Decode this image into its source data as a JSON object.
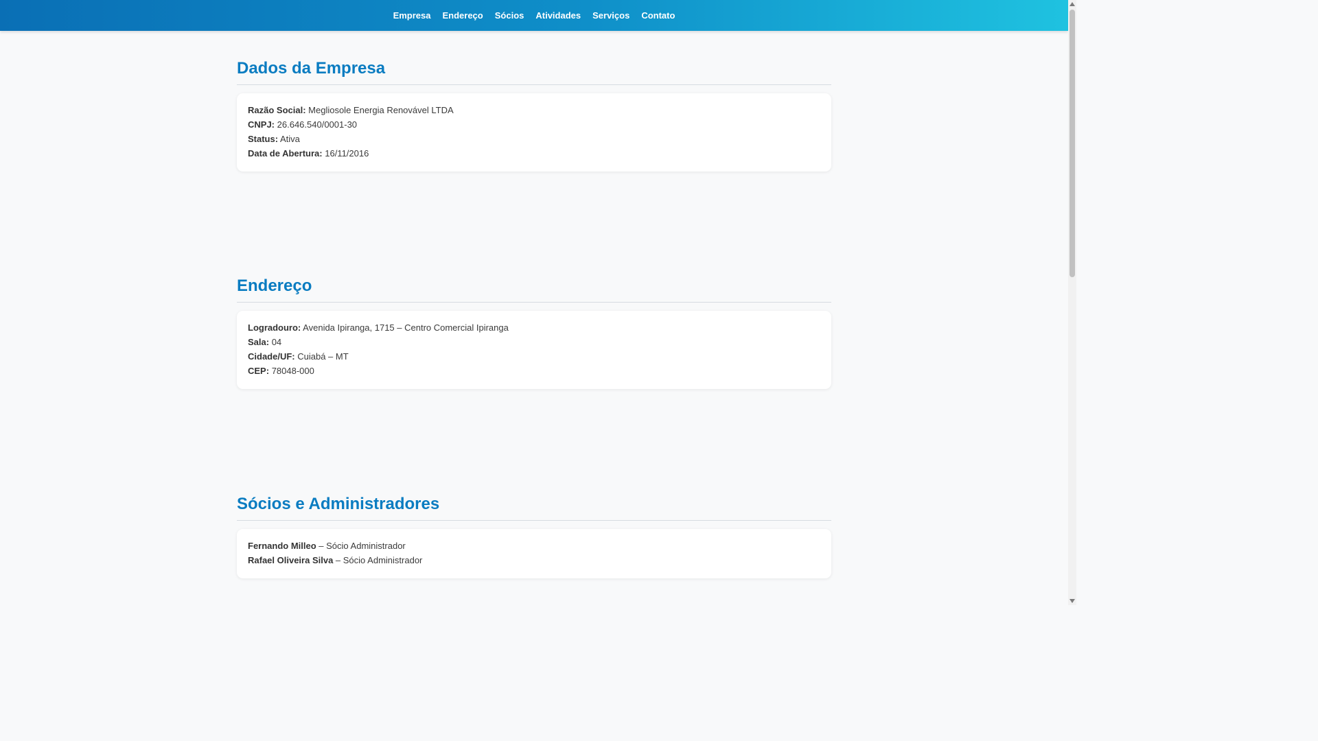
{
  "nav": {
    "items": [
      {
        "label": "Empresa"
      },
      {
        "label": "Endereço"
      },
      {
        "label": "Sócios"
      },
      {
        "label": "Atividades"
      },
      {
        "label": "Serviços"
      },
      {
        "label": "Contato"
      }
    ]
  },
  "empresa": {
    "title": "Dados da Empresa",
    "razao_label": "Razão Social:",
    "razao_value": "Megliosole Energia Renovável LTDA",
    "cnpj_label": "CNPJ:",
    "cnpj_value": "26.646.540/0001-30",
    "status_label": "Status:",
    "status_value": "Ativa",
    "abertura_label": "Data de Abertura:",
    "abertura_value": "16/11/2016"
  },
  "endereco": {
    "title": "Endereço",
    "logradouro_label": "Logradouro:",
    "logradouro_value": "Avenida Ipiranga, 1715 – Centro Comercial Ipiranga",
    "sala_label": "Sala:",
    "sala_value": "04",
    "cidade_label": "Cidade/UF:",
    "cidade_value": "Cuiabá – MT",
    "cep_label": "CEP:",
    "cep_value": "78048-000"
  },
  "socios": {
    "title": "Sócios e Administradores",
    "items": [
      {
        "name": "Fernando Milleo",
        "role": "– Sócio Administrador"
      },
      {
        "name": "Rafael Oliveira Silva",
        "role": "– Sócio Administrador"
      }
    ]
  },
  "colors": {
    "nav_gradient_start": "#0a6fb5",
    "nav_gradient_end": "#1fc2e0",
    "section_title": "#0a7cc1",
    "card_background": "#ffffff",
    "page_background": "#f8f9fa"
  }
}
